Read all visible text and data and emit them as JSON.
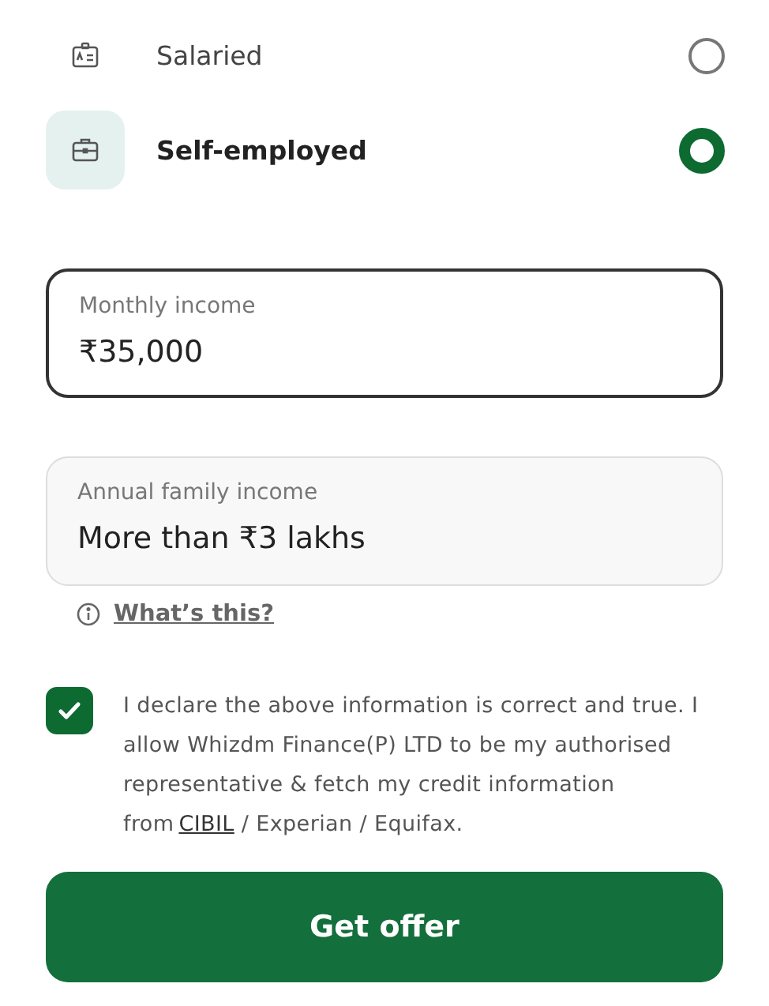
{
  "employment_options": [
    {
      "label": "Salaried",
      "kind": "id-card",
      "selected": false
    },
    {
      "label": "Self-employed",
      "kind": "briefcase",
      "selected": true
    }
  ],
  "fields": [
    {
      "label": "Monthly income",
      "value": "₹35,000",
      "focused": true
    },
    {
      "label": "Annual family income",
      "value": "More than ₹3 lakhs",
      "focused": false
    }
  ],
  "help_link": "What’s this?",
  "declaration": {
    "checked": true,
    "text_before": "I declare the above information is correct and true. I allow Whizdm Finance(P) LTD to be my authorised representative & fetch my credit information from",
    "link": "CIBIL",
    "text_after": " / Experian / Equifax."
  },
  "submit_button": "Get offer"
}
